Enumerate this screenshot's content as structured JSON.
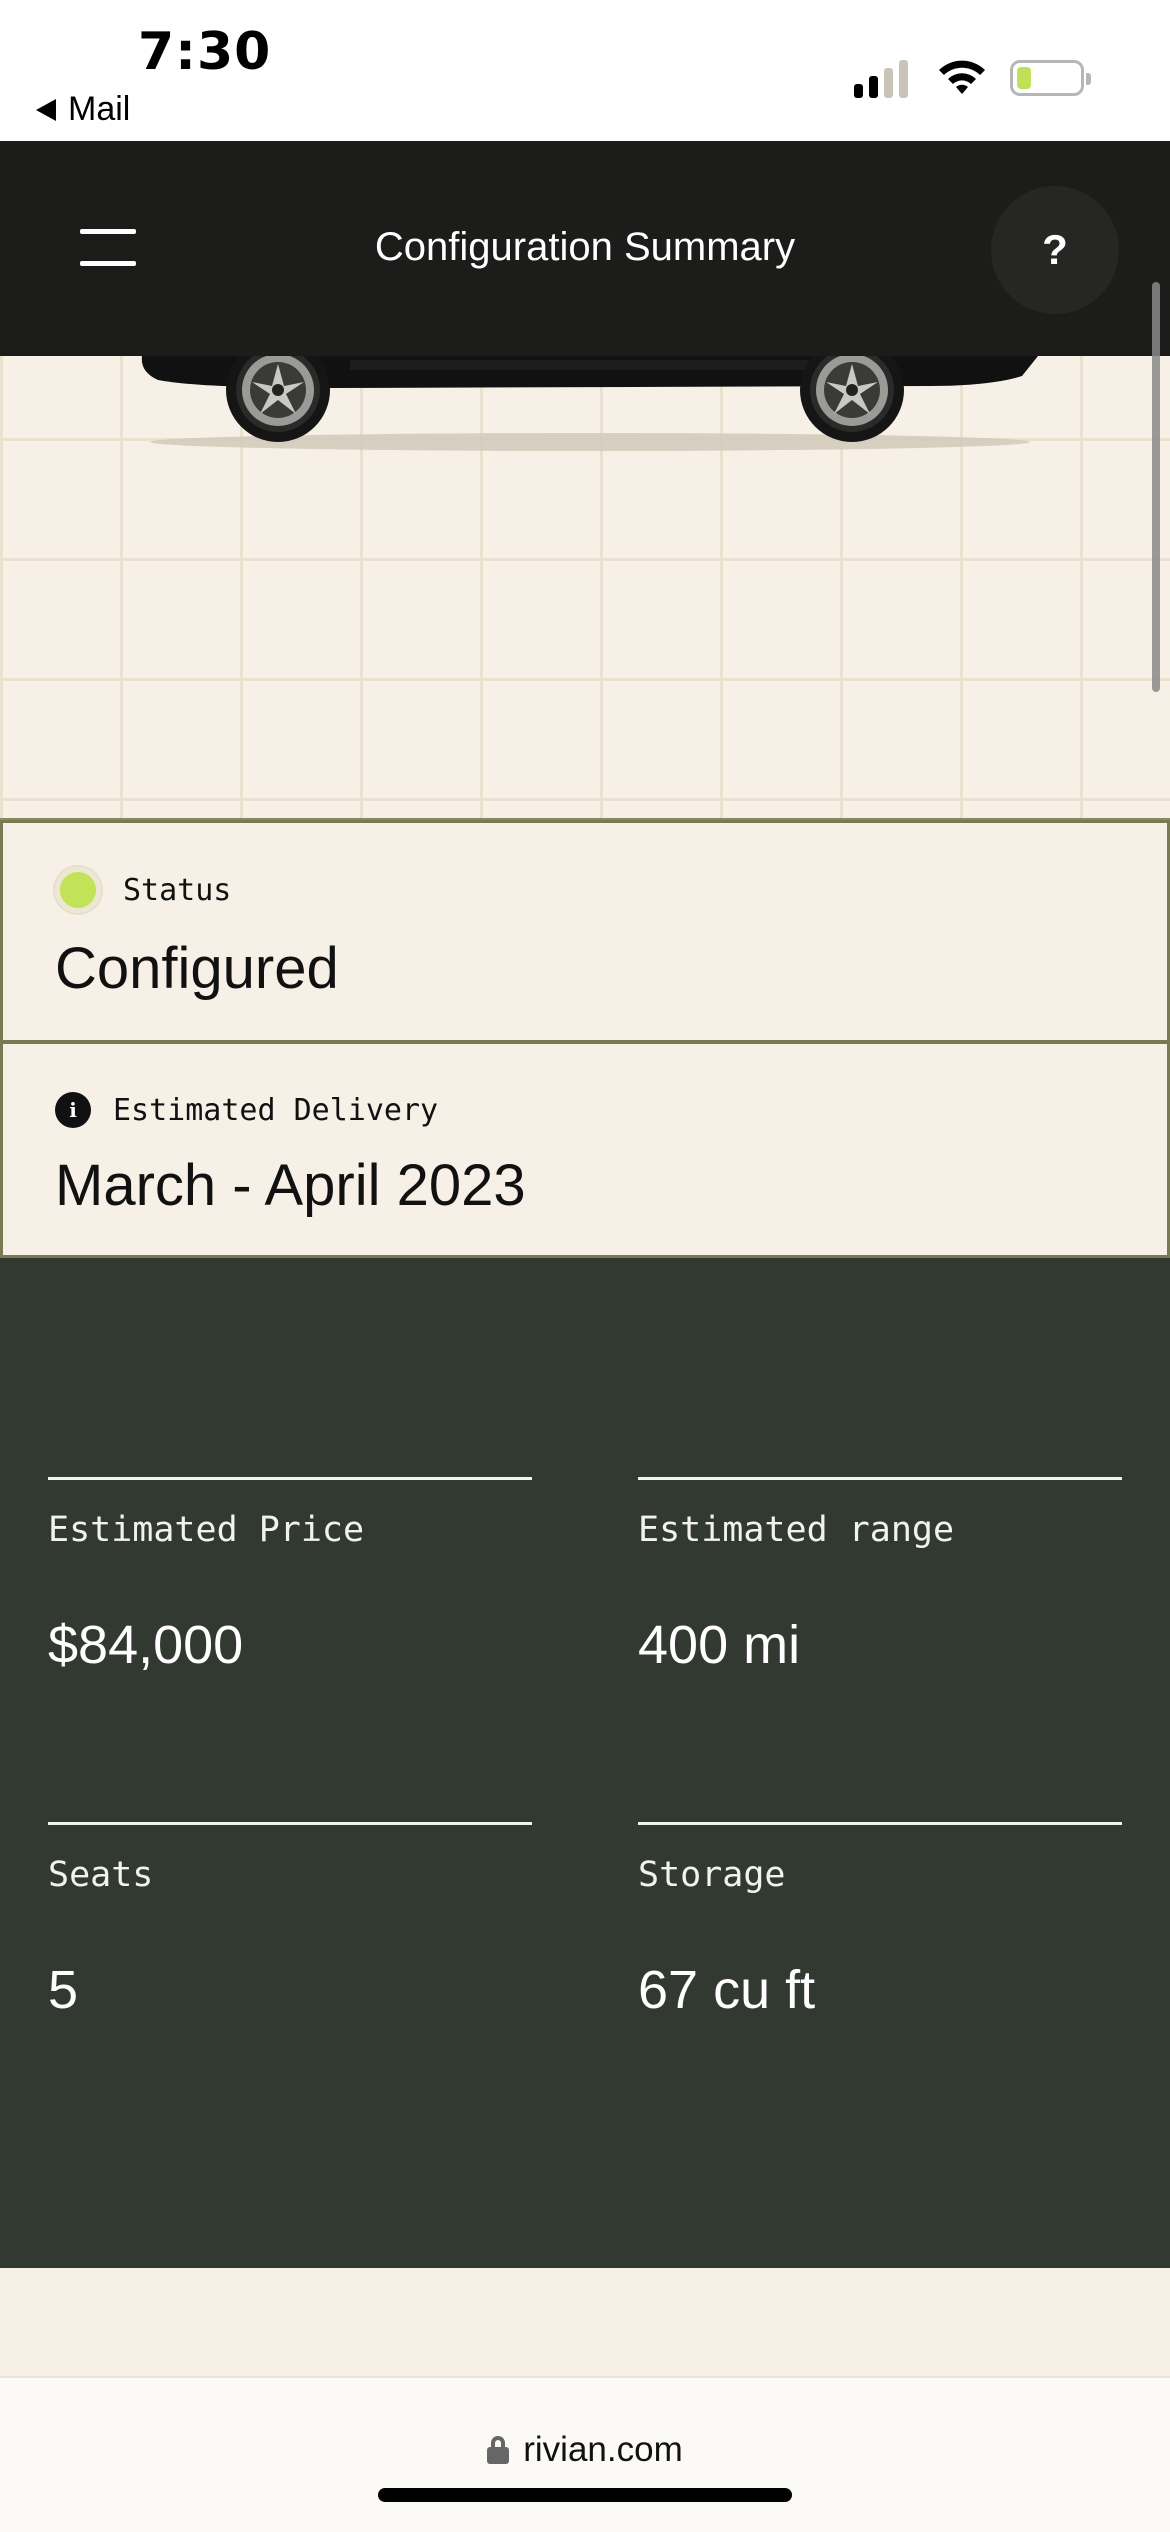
{
  "status_bar": {
    "time": "7:30",
    "back_app": "Mail",
    "battery_color": "#c1e05a"
  },
  "nav": {
    "title": "Configuration Summary",
    "help_label": "?",
    "menu_icon": "hamburger-menu-icon"
  },
  "status_card": {
    "label": "Status",
    "value": "Configured",
    "indicator_color": "#c2e257"
  },
  "delivery_card": {
    "label": "Estimated Delivery",
    "value": "March - April 2023",
    "icon": "info-icon",
    "icon_glyph": "i"
  },
  "specs": [
    {
      "label": "Estimated Price",
      "value": "$84,000"
    },
    {
      "label": "Estimated range",
      "value": "400 mi"
    },
    {
      "label": "Seats",
      "value": "5"
    },
    {
      "label": "Storage",
      "value": "67 cu ft"
    }
  ],
  "browser": {
    "url": "rivian.com"
  },
  "colors": {
    "nav_bg": "#1c1c1b",
    "page_bg": "#f6f0e7",
    "specs_bg": "#323930"
  }
}
